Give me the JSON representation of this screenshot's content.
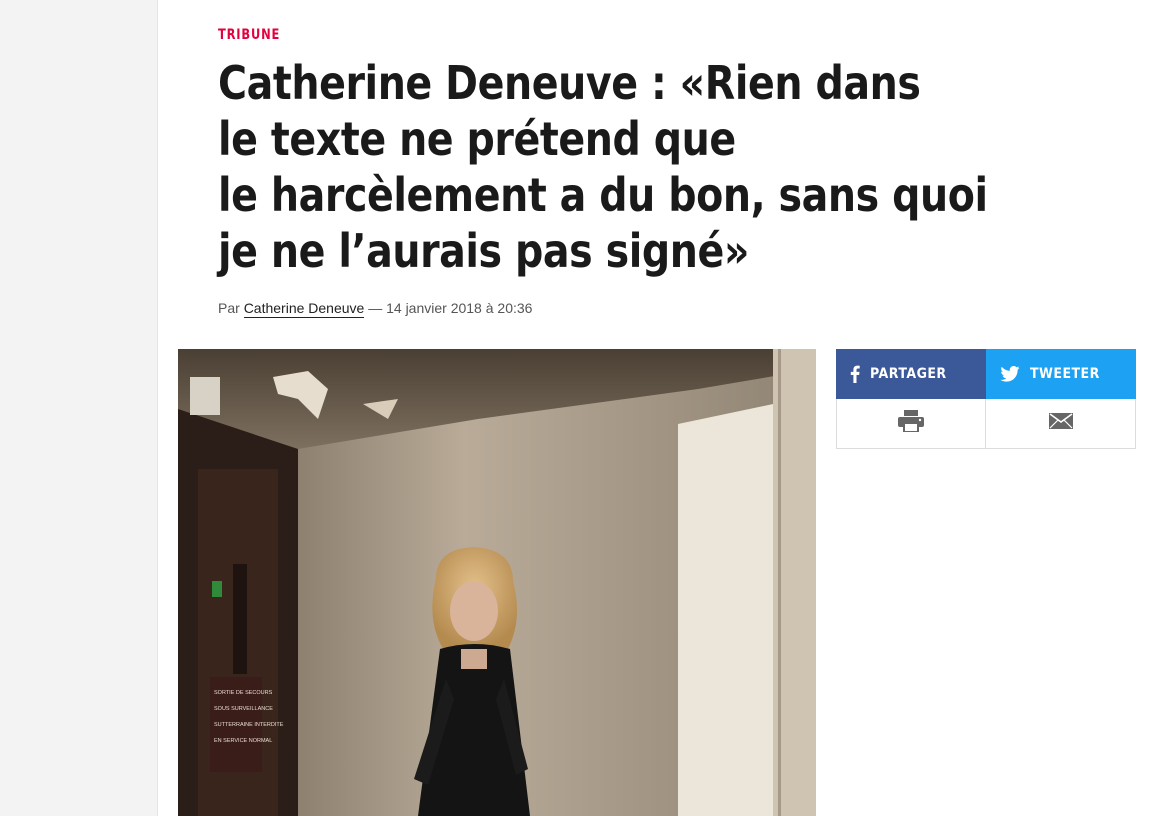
{
  "article": {
    "rubric": "TRIBUNE",
    "title_lines": [
      "Catherine Deneuve : «Rien dans",
      "le texte ne prétend que",
      "le harcèlement a du bon, sans quoi",
      "je ne l’aurais pas signé»"
    ],
    "byline_prefix": "Par",
    "author": "Catherine Deneuve",
    "date_separator": "—",
    "date": "14 janvier 2018 à 20:36"
  },
  "share": {
    "facebook_label": "PARTAGER",
    "twitter_label": "TWEETER",
    "print_icon": "print-icon",
    "email_icon": "envelope-icon"
  },
  "photo": {
    "sign_lines": [
      "SORTIE DE SECOURS",
      "SOUS SURVEILLANCE",
      "SUTTERRAINE INTERDITE",
      "EN SERVICE NORMAL"
    ]
  },
  "colors": {
    "rubric": "#e2003f",
    "facebook": "#3b5998",
    "twitter": "#1da1f2"
  }
}
